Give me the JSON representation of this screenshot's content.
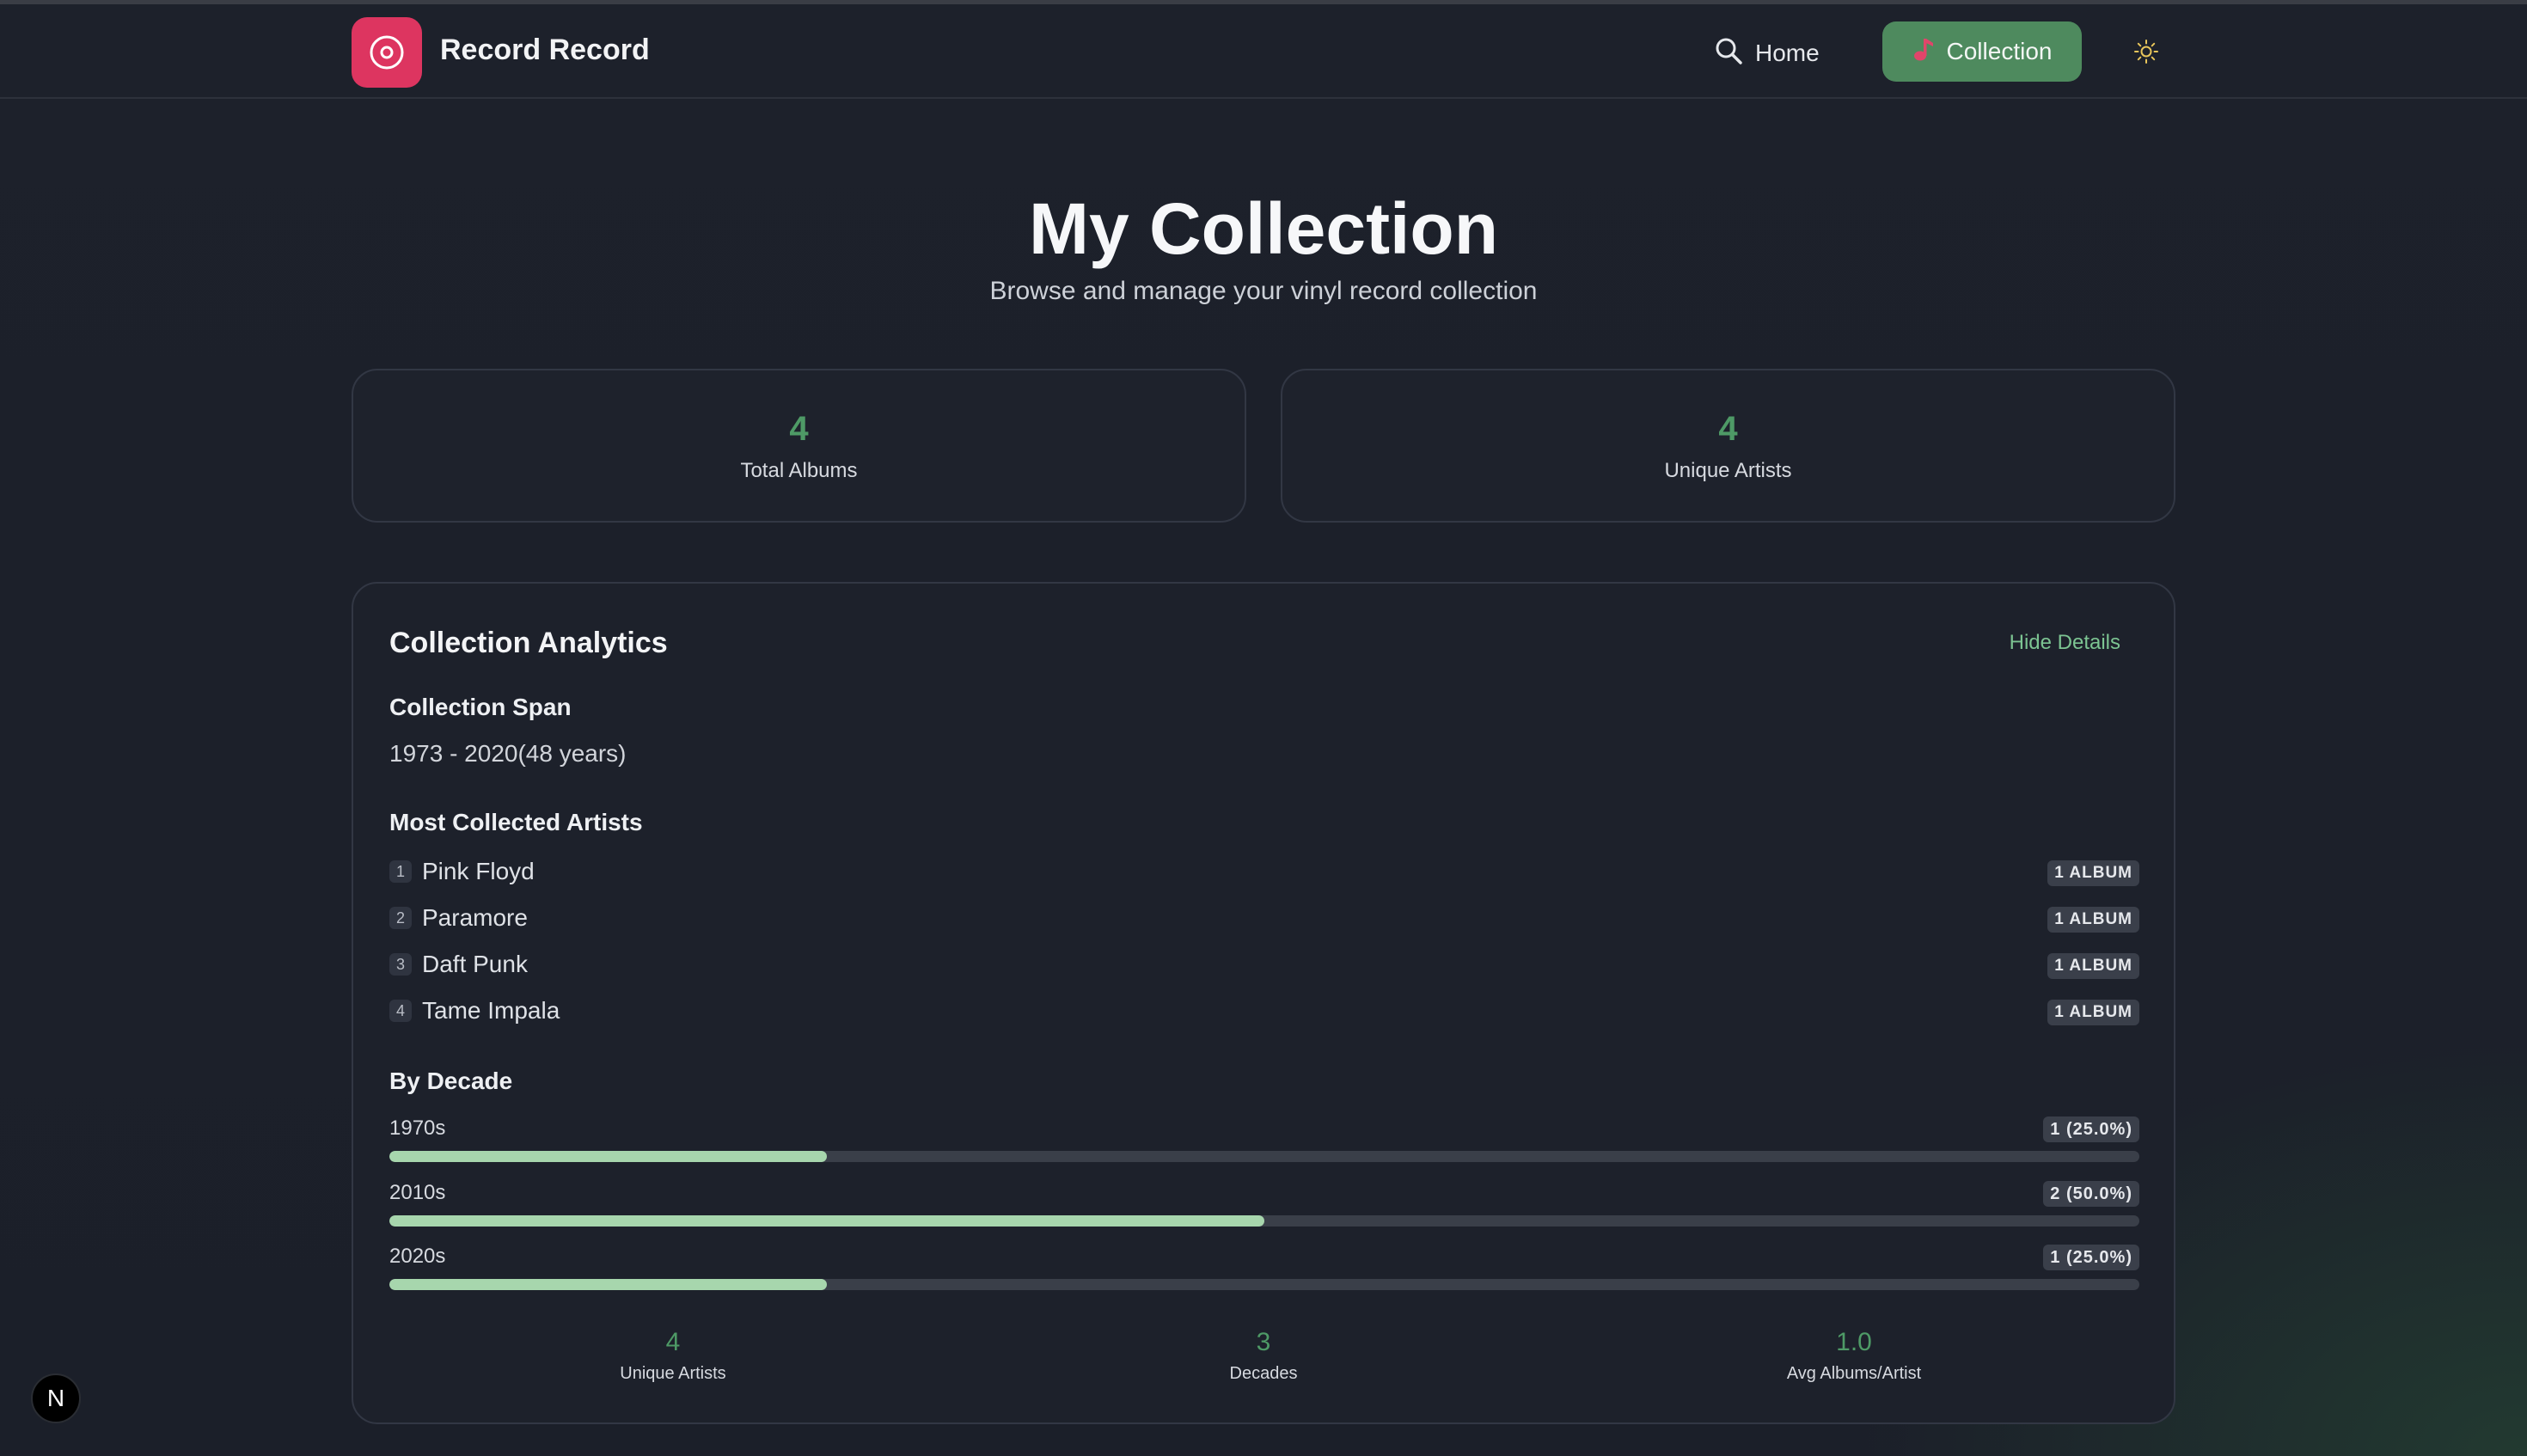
{
  "header": {
    "brand": "Record Record",
    "nav": {
      "home_label": "Home",
      "collection_label": "Collection"
    }
  },
  "page": {
    "title": "My Collection",
    "subtitle": "Browse and manage your vinyl record collection"
  },
  "stats": [
    {
      "value": "4",
      "label": "Total Albums"
    },
    {
      "value": "4",
      "label": "Unique Artists"
    }
  ],
  "analytics": {
    "title": "Collection Analytics",
    "toggle_label": "Hide Details",
    "span": {
      "heading": "Collection Span",
      "value": "1973 - 2020(48 years)"
    },
    "artists": {
      "heading": "Most Collected Artists",
      "items": [
        {
          "rank": "1",
          "name": "Pink Floyd",
          "badge": "1 ALBUM"
        },
        {
          "rank": "2",
          "name": "Paramore",
          "badge": "1 ALBUM"
        },
        {
          "rank": "3",
          "name": "Daft Punk",
          "badge": "1 ALBUM"
        },
        {
          "rank": "4",
          "name": "Tame Impala",
          "badge": "1 ALBUM"
        }
      ]
    },
    "decades": {
      "heading": "By Decade",
      "items": [
        {
          "label": "1970s",
          "count": "1 (25.0%)",
          "percent": 25
        },
        {
          "label": "2010s",
          "count": "2 (50.0%)",
          "percent": 50
        },
        {
          "label": "2020s",
          "count": "1 (25.0%)",
          "percent": 25
        }
      ]
    },
    "summary": [
      {
        "value": "4",
        "label": "Unique Artists"
      },
      {
        "value": "3",
        "label": "Decades"
      },
      {
        "value": "1.0",
        "label": "Avg Albums/Artist"
      }
    ]
  },
  "dev_badge": "N",
  "colors": {
    "accent_green": "#4e8a5e",
    "stat_green": "#4e9a66",
    "brand_pink": "#dd3560",
    "bar_fill": "#a7d6ad"
  },
  "icons": {
    "logo": "vinyl-record-icon",
    "home": "search-icon",
    "collection": "music-note-icon",
    "theme": "sun-icon"
  }
}
